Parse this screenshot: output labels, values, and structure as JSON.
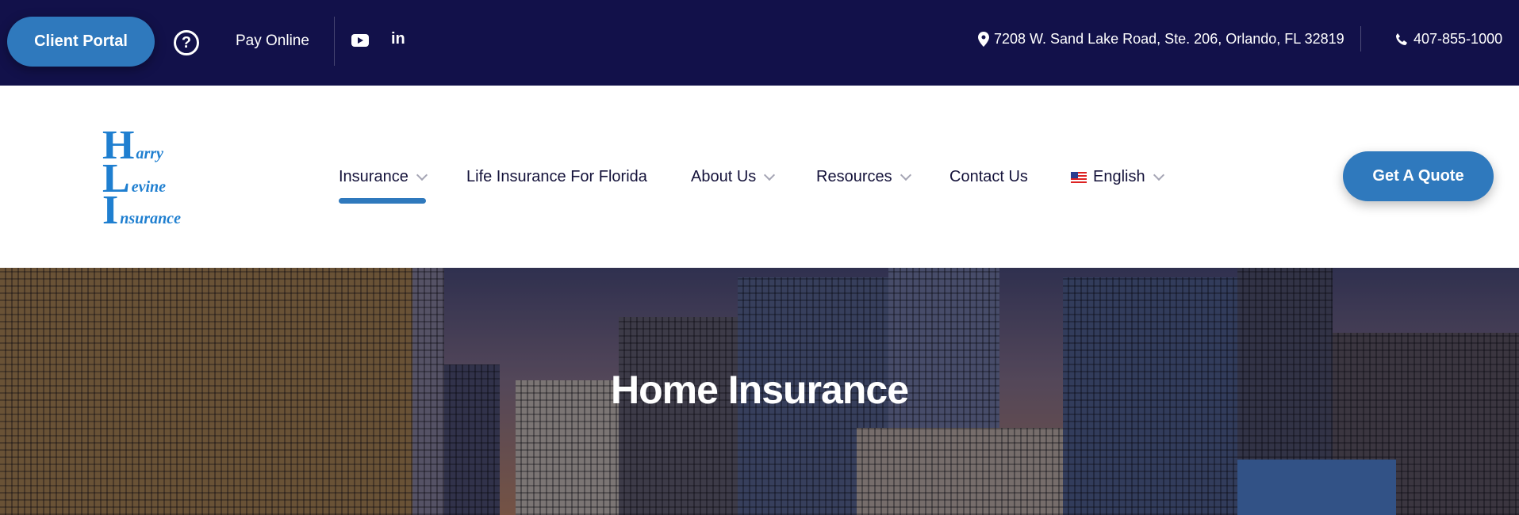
{
  "topbar": {
    "client_portal": "Client Portal",
    "help_icon": "?",
    "pay_online": "Pay Online",
    "linkedin": "in",
    "address": "7208 W. Sand Lake Road, Ste. 206, Orlando, FL 32819",
    "phone": "407-855-1000"
  },
  "logo": {
    "line1_big": "H",
    "line1_small": "arry",
    "line2_big": "L",
    "line2_small": "evine",
    "line3_big": "I",
    "line3_small": "nsurance"
  },
  "nav": {
    "insurance": "Insurance",
    "life": "Life Insurance For Florida",
    "about": "About Us",
    "resources": "Resources",
    "contact": "Contact Us",
    "language": "English"
  },
  "cta": {
    "quote": "Get A Quote"
  },
  "hero": {
    "title": "Home Insurance"
  },
  "colors": {
    "topbar": "#12114a",
    "accent": "#2f79bd",
    "logo": "#1f7fd0"
  }
}
